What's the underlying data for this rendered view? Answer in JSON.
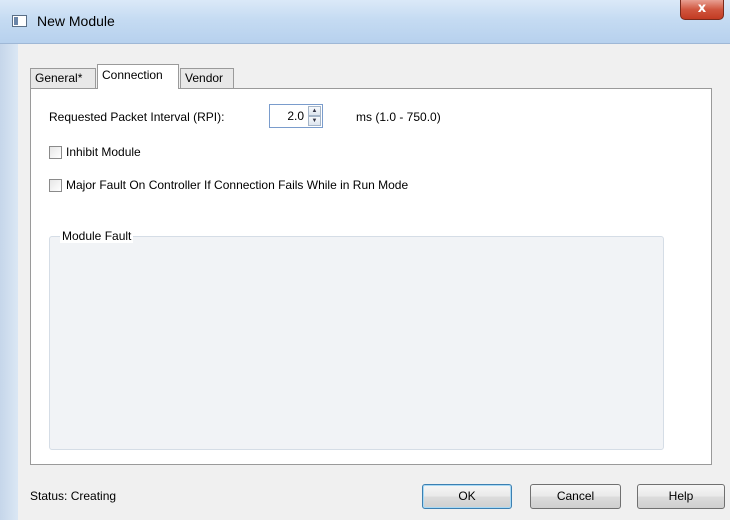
{
  "window": {
    "title": "New Module",
    "close_glyph": "x",
    "icon": "module-window-icon"
  },
  "tabs": [
    {
      "label": "General*",
      "active": false
    },
    {
      "label": "Connection",
      "active": true
    },
    {
      "label": "Vendor",
      "active": false
    }
  ],
  "connection": {
    "rpi_label": "Requested Packet Interval (RPI):",
    "rpi_value": "2.0",
    "rpi_units": "ms (1.0 - 750.0)",
    "spin_up": "▲",
    "spin_down": "▼",
    "inhibit_label": "Inhibit Module",
    "inhibit_checked": false,
    "major_fault_label": "Major Fault On Controller If Connection Fails While in Run Mode",
    "major_fault_checked": false,
    "module_fault_legend": "Module Fault"
  },
  "status": {
    "text": "Status:  Creating"
  },
  "buttons": {
    "ok": "OK",
    "cancel": "Cancel",
    "help": "Help"
  },
  "colors": {
    "titlebar": "#c5dbf2",
    "close": "#c23b22",
    "default_button_border": "#3c7fb1"
  }
}
